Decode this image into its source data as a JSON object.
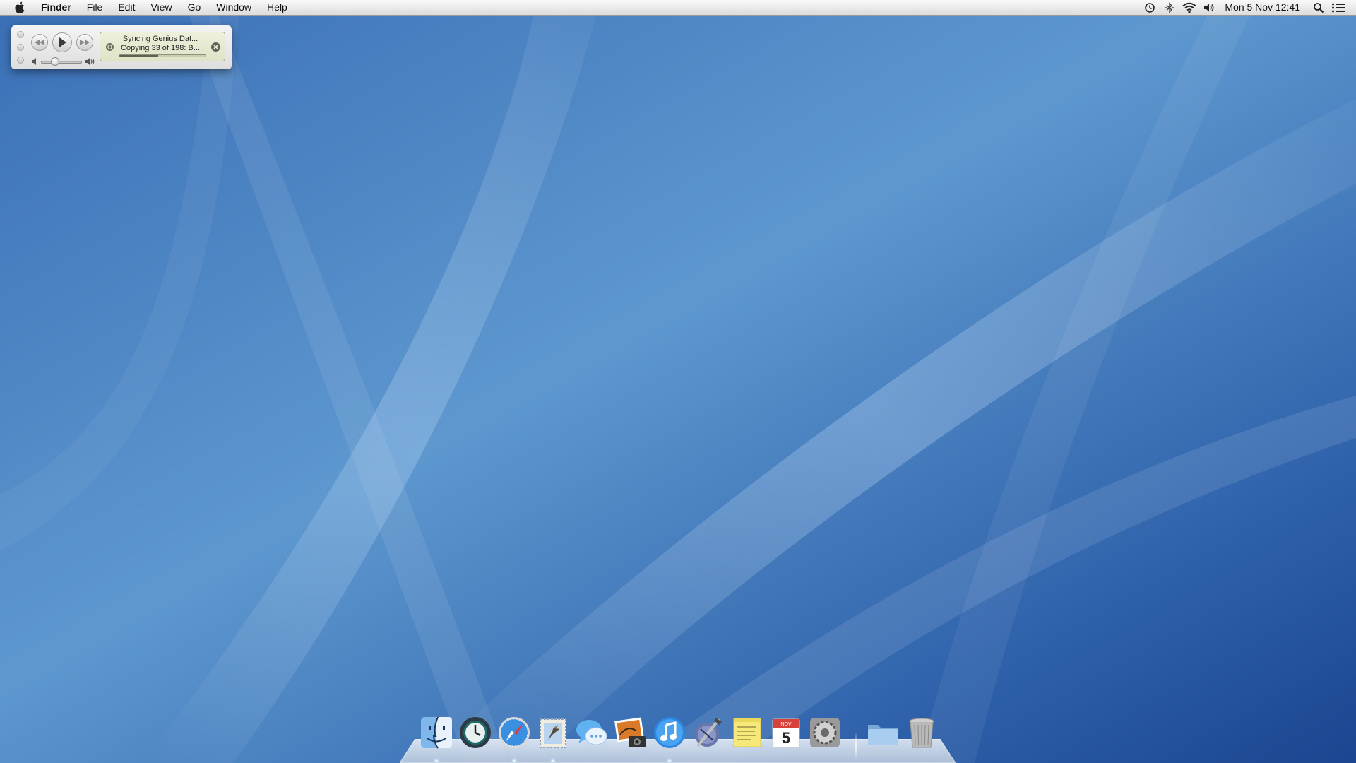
{
  "menubar": {
    "apple_icon": "apple-icon",
    "app_name": "Finder",
    "menus": [
      "File",
      "Edit",
      "View",
      "Go",
      "Window",
      "Help"
    ],
    "status_icons": [
      "time-machine-icon",
      "bluetooth-icon",
      "wifi-icon",
      "volume-icon"
    ],
    "clock": "Mon 5 Nov  12:41",
    "right_icons": [
      "spotlight-icon",
      "notification-center-icon"
    ]
  },
  "mini_player": {
    "line1": "Syncing Genius Dat...",
    "line2": "Copying 33 of 198: B...",
    "sync_progress": 0.45,
    "volume_level": 0.3
  },
  "dock": {
    "apps": [
      "Finder",
      "Time Machine",
      "Safari",
      "Mail",
      "Messages",
      "iPhoto",
      "iTunes",
      "Xcode",
      "Stickies",
      "Calendar",
      "System Preferences"
    ],
    "calendar_day": "5",
    "calendar_month": "NOV",
    "stacks": [
      "Folder",
      "Trash"
    ]
  },
  "colors": {
    "accent": "#2f6fb8",
    "wallpaper_dark": "#1f4f98",
    "wallpaper_light": "#6aa3d4"
  }
}
